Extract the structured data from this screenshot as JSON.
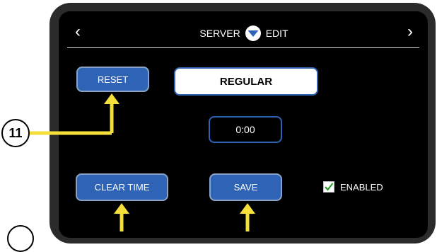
{
  "header": {
    "title_left": "SERVER",
    "title_right": "EDIT",
    "prev_icon": "chevron-left-icon",
    "next_icon": "chevron-right-icon",
    "badge_icon": "chevron-down-badge-icon"
  },
  "buttons": {
    "reset": "RESET",
    "mode": "REGULAR",
    "time": "0:00",
    "clear_time": "CLEAR TIME",
    "save": "SAVE"
  },
  "enabled": {
    "label": "ENABLED",
    "checked": true
  },
  "callouts": {
    "callout_11": "11"
  },
  "colors": {
    "accent": "#2f63b5",
    "arrow": "#f5e03b",
    "screen": "#000000",
    "bezel": "#2b2b2b"
  }
}
